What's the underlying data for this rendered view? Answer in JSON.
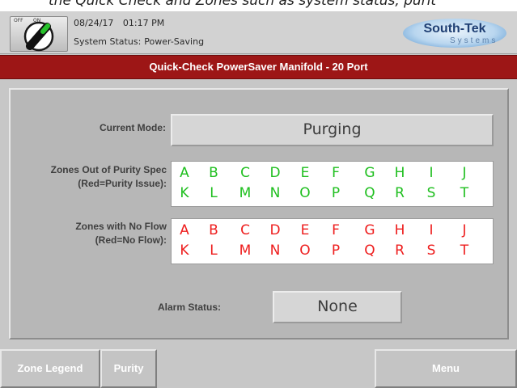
{
  "caption": "the Quick Check and Zones such as system status, purit",
  "header": {
    "power_switch": {
      "off_label": "OFF",
      "on_label": "ON",
      "icon": "power-toggle-icon",
      "accent": "#27c22b"
    },
    "date": "08/24/17",
    "time": "01:17 PM",
    "status_label": "System Status:",
    "status_value": "Power-Saving",
    "logo": {
      "brand": "South-Tek",
      "sub": "Systems"
    }
  },
  "title": "Quick-Check PowerSaver Manifold - 20 Port",
  "title_color": "#9d1616",
  "current_mode": {
    "label": "Current Mode:",
    "value": "Purging"
  },
  "purity": {
    "label_line1": "Zones Out of Purity Spec",
    "label_line2": "(Red=Purity Issue):",
    "row1": [
      "A",
      "B",
      "C",
      "D",
      "E",
      "F",
      "G",
      "H",
      "I",
      "J"
    ],
    "row2": [
      "K",
      "L",
      "M",
      "N",
      "O",
      "P",
      "Q",
      "R",
      "S",
      "T"
    ],
    "status_color": "#1fbf1f"
  },
  "flow": {
    "label_line1": "Zones with No Flow",
    "label_line2": "(Red=No Flow):",
    "row1": [
      "A",
      "B",
      "C",
      "D",
      "E",
      "F",
      "G",
      "H",
      "I",
      "J"
    ],
    "row2": [
      "K",
      "L",
      "M",
      "N",
      "O",
      "P",
      "Q",
      "R",
      "S",
      "T"
    ],
    "status_color": "#ee1d1d"
  },
  "alarm": {
    "label": "Alarm Status:",
    "value": "None"
  },
  "buttons": {
    "zone_legend": "Zone Legend",
    "purity": "Purity",
    "menu": "Menu"
  }
}
